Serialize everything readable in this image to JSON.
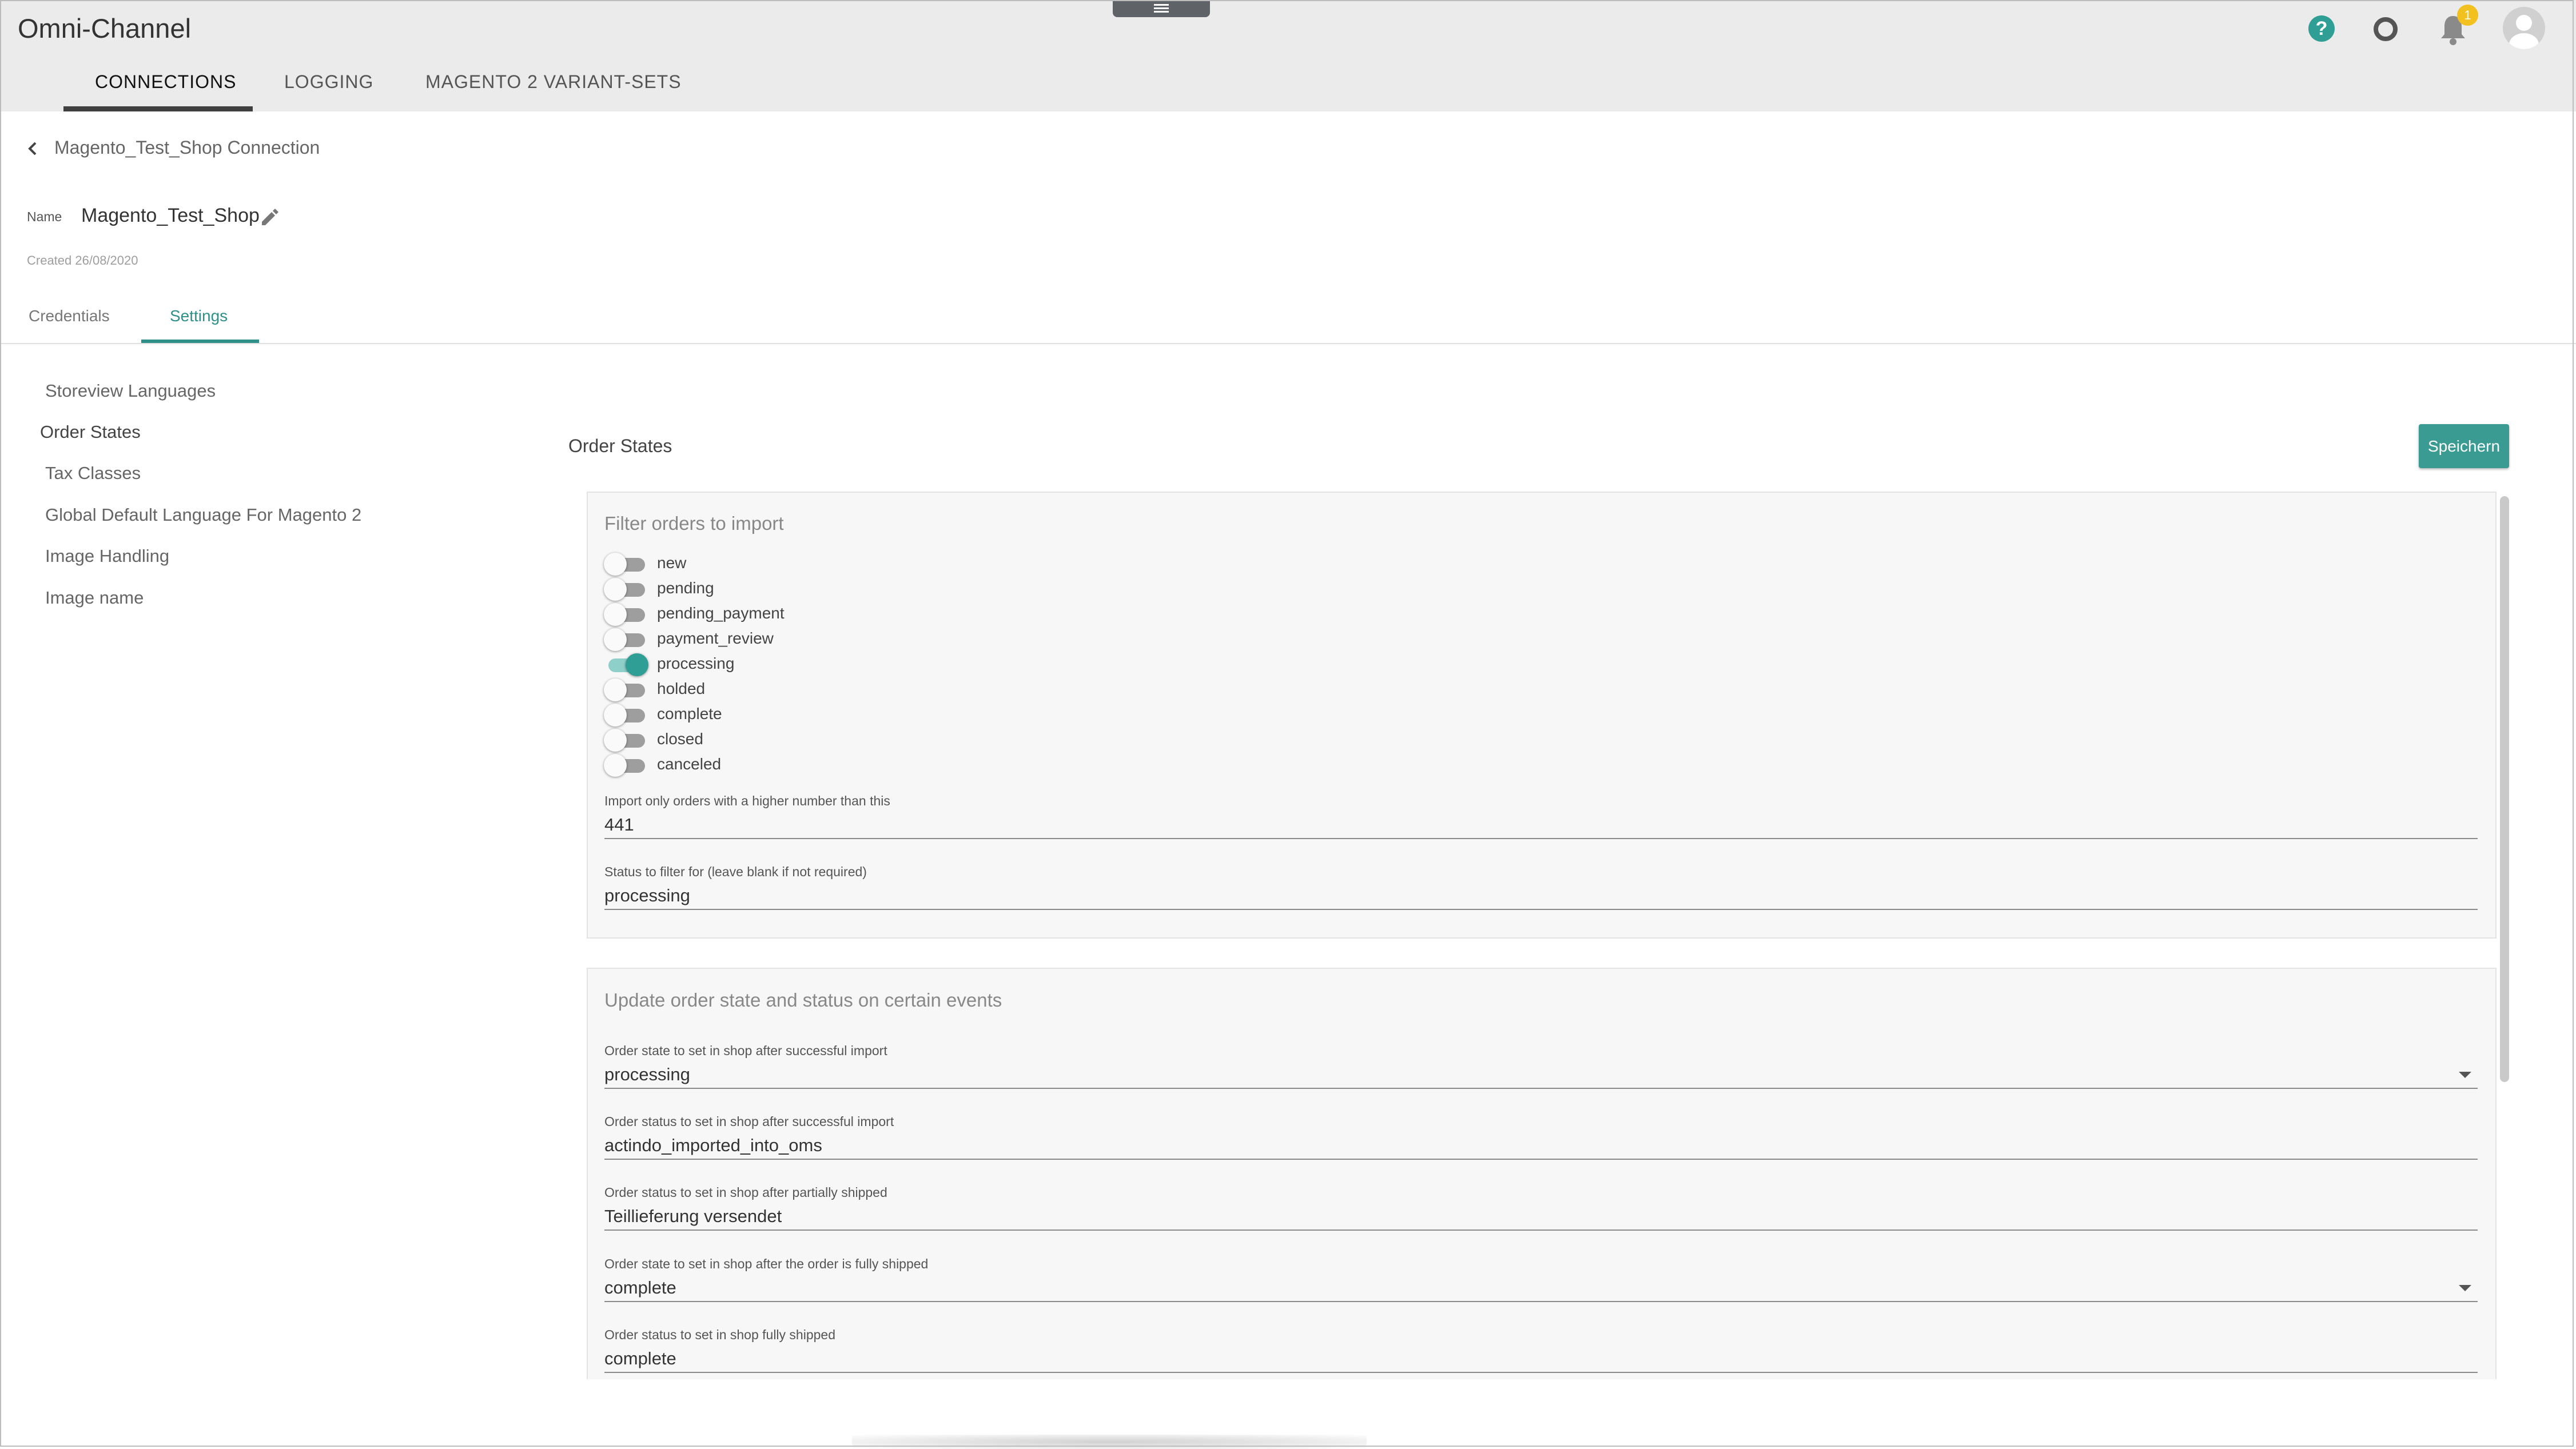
{
  "app": {
    "title": "Omni-Channel"
  },
  "nav": {
    "tabs": [
      {
        "label": "CONNECTIONS"
      },
      {
        "label": "LOGGING"
      },
      {
        "label": "MAGENTO 2 VARIANT-SETS"
      }
    ]
  },
  "topbar": {
    "notifications_count": "1",
    "icons": [
      "help-icon",
      "settings-ring-icon",
      "bell-icon",
      "avatar"
    ]
  },
  "breadcrumb": {
    "label": "Magento_Test_Shop Connection"
  },
  "header": {
    "name_label": "Name",
    "name_value": "Magento_Test_Shop",
    "created": "Created 26/08/2020"
  },
  "subtabs": [
    {
      "label": "Credentials"
    },
    {
      "label": "Settings"
    }
  ],
  "sidebar": {
    "items": [
      {
        "label": "Storeview Languages"
      },
      {
        "label": "Order States"
      },
      {
        "label": "Tax Classes"
      },
      {
        "label": "Global Default Language For Magento 2"
      },
      {
        "label": "Image Handling"
      },
      {
        "label": "Image name"
      }
    ]
  },
  "main": {
    "title": "Order States",
    "save_label": "Speichern",
    "filter": {
      "title": "Filter orders to import",
      "states": [
        {
          "label": "new",
          "on": false
        },
        {
          "label": "pending",
          "on": false
        },
        {
          "label": "pending_payment",
          "on": false
        },
        {
          "label": "payment_review",
          "on": false
        },
        {
          "label": "processing",
          "on": true
        },
        {
          "label": "holded",
          "on": false
        },
        {
          "label": "complete",
          "on": false
        },
        {
          "label": "closed",
          "on": false
        },
        {
          "label": "canceled",
          "on": false
        }
      ],
      "fields": [
        {
          "label": "Import only orders with a higher number than this",
          "value": "441"
        },
        {
          "label": "Status to filter for (leave blank if not required)",
          "value": "processing"
        }
      ]
    },
    "update": {
      "title": "Update order state and status on certain events",
      "fields": [
        {
          "label": "Order state to set in shop after successful import",
          "value": "processing"
        },
        {
          "label": "Order status to set in shop after successful import",
          "value": "actindo_imported_into_oms"
        },
        {
          "label": "Order status to set in shop after partially shipped",
          "value": "Teillieferung versendet"
        },
        {
          "label": "Order state to set in shop after the order is fully shipped",
          "value": "complete"
        },
        {
          "label": "Order status to set in shop fully shipped",
          "value": "complete"
        }
      ]
    }
  }
}
